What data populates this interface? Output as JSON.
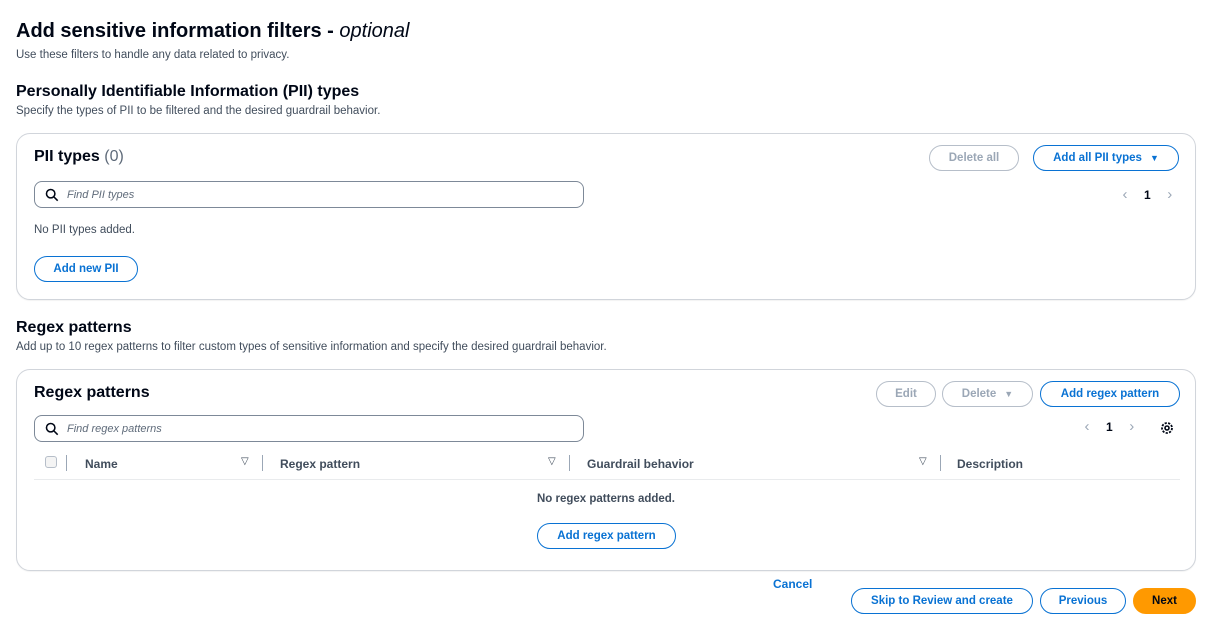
{
  "page": {
    "title": "Add sensitive information filters - ",
    "title_optional": "optional",
    "description": "Use these filters to handle any data related to privacy."
  },
  "pii_section": {
    "heading": "Personally Identifiable Information (PII) types",
    "description": "Specify the types of PII to be filtered and the desired guardrail behavior.",
    "box_title": "PII types",
    "count": "(0)",
    "delete_all_label": "Delete all",
    "add_all_label": "Add all PII types",
    "search_placeholder": "Find PII types",
    "page_number": "1",
    "empty_text": "No PII types added.",
    "add_new_label": "Add new PII"
  },
  "regex_section": {
    "heading": "Regex patterns",
    "description": "Add up to 10 regex patterns to filter custom types of sensitive information and specify the desired guardrail behavior.",
    "box_title": "Regex patterns",
    "edit_label": "Edit",
    "delete_label": "Delete",
    "add_label": "Add regex pattern",
    "search_placeholder": "Find regex patterns",
    "page_number": "1",
    "columns": [
      "Name",
      "Regex pattern",
      "Guardrail behavior",
      "Description"
    ],
    "empty_text": "No regex patterns added.",
    "empty_add_label": "Add regex pattern"
  },
  "footer": {
    "cancel_label": "Cancel",
    "skip_label": "Skip to Review and create",
    "previous_label": "Previous",
    "next_label": "Next"
  },
  "colors": {
    "accent": "#0972d3",
    "primary_button": "#ff9900",
    "disabled": "#9ba7b6"
  }
}
